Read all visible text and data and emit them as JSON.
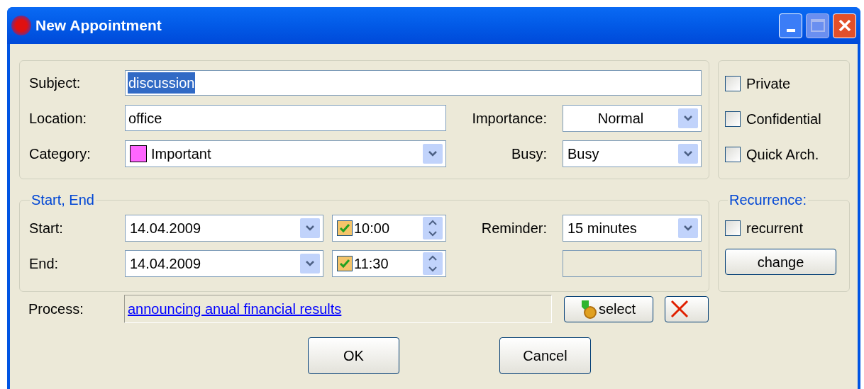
{
  "window": {
    "title": "New Appointment"
  },
  "details": {
    "subject": {
      "label": "Subject:",
      "value": "discussion",
      "text_selected": true
    },
    "location": {
      "label": "Location:",
      "value": "office"
    },
    "category": {
      "label": "Category:",
      "value": "Important",
      "color": "#ff66ff"
    },
    "importance": {
      "label": "Importance:",
      "value": "Normal"
    },
    "busy": {
      "label": "Busy:",
      "value": "Busy"
    }
  },
  "flags": [
    {
      "label": "Private",
      "checked": false
    },
    {
      "label": "Confidential",
      "checked": false
    },
    {
      "label": "Quick Arch.",
      "checked": false
    }
  ],
  "schedule": {
    "title": "Start, End",
    "start": {
      "label": "Start:",
      "date": "14.04.2009",
      "time": "10:00",
      "time_checked": true
    },
    "end": {
      "label": "End:",
      "date": "14.04.2009",
      "time": "11:30",
      "time_checked": true
    },
    "reminder": {
      "label": "Reminder:",
      "value": "15 minutes"
    }
  },
  "recurrence": {
    "title": "Recurrence:",
    "option": {
      "label": "recurrent",
      "checked": false
    },
    "button": "change"
  },
  "process": {
    "label": "Process:",
    "value": "announcing anual financial results",
    "select_button": "select"
  },
  "buttons": [
    "OK",
    "Cancel"
  ]
}
